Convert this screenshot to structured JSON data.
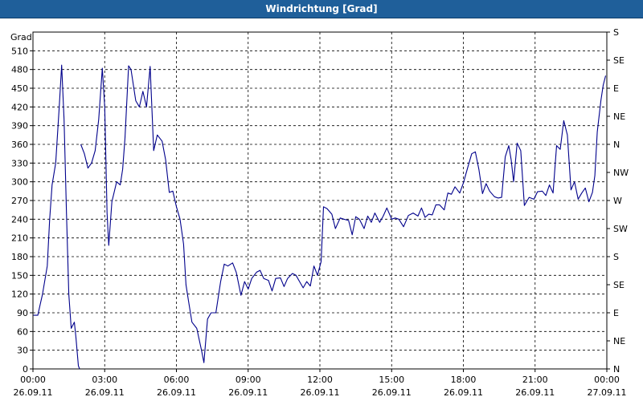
{
  "window": {
    "title": "Windrichtung [Grad]"
  },
  "chart_data": {
    "type": "line",
    "title": "Windrichtung [Grad]",
    "ylabel": "Grad",
    "ylim": [
      0,
      540
    ],
    "xlim": [
      0,
      24
    ],
    "grid": true,
    "yticks": [
      0,
      30,
      60,
      90,
      120,
      150,
      180,
      210,
      240,
      270,
      300,
      330,
      360,
      390,
      420,
      450,
      480,
      510
    ],
    "right_ticks": [
      {
        "value": 0,
        "label": "N"
      },
      {
        "value": 45,
        "label": "NE"
      },
      {
        "value": 90,
        "label": "E"
      },
      {
        "value": 135,
        "label": "SE"
      },
      {
        "value": 180,
        "label": "S"
      },
      {
        "value": 225,
        "label": "SW"
      },
      {
        "value": 270,
        "label": "W"
      },
      {
        "value": 315,
        "label": "NW"
      },
      {
        "value": 360,
        "label": "N"
      },
      {
        "value": 405,
        "label": "NE"
      },
      {
        "value": 450,
        "label": "E"
      },
      {
        "value": 495,
        "label": "SE"
      },
      {
        "value": 540,
        "label": "S"
      }
    ],
    "xticks": [
      {
        "value": 0,
        "time": "00:00",
        "date": "26.09.11"
      },
      {
        "value": 3,
        "time": "03:00",
        "date": "26.09.11"
      },
      {
        "value": 6,
        "time": "06:00",
        "date": "26.09.11"
      },
      {
        "value": 9,
        "time": "09:00",
        "date": "26.09.11"
      },
      {
        "value": 12,
        "time": "12:00",
        "date": "26.09.11"
      },
      {
        "value": 15,
        "time": "15:00",
        "date": "26.09.11"
      },
      {
        "value": 18,
        "time": "18:00",
        "date": "26.09.11"
      },
      {
        "value": 21,
        "time": "21:00",
        "date": "26.09.11"
      },
      {
        "value": 24,
        "time": "00:00",
        "date": "27.09.11"
      }
    ],
    "series": [
      {
        "color": "#00008b",
        "segments": [
          [
            [
              0.02,
              86
            ],
            [
              0.2,
              86
            ],
            [
              0.4,
              120
            ],
            [
              0.6,
              165
            ],
            [
              0.7,
              240
            ],
            [
              0.8,
              295
            ],
            [
              0.95,
              330
            ],
            [
              1.1,
              420
            ],
            [
              1.2,
              487
            ],
            [
              1.3,
              400
            ],
            [
              1.4,
              250
            ],
            [
              1.5,
              120
            ],
            [
              1.6,
              65
            ],
            [
              1.73,
              75
            ],
            [
              1.8,
              50
            ],
            [
              1.9,
              5
            ],
            [
              1.95,
              0
            ]
          ],
          [
            [
              2.0,
              360
            ],
            [
              2.15,
              345
            ],
            [
              2.3,
              322
            ],
            [
              2.45,
              330
            ],
            [
              2.6,
              350
            ],
            [
              2.75,
              400
            ],
            [
              2.9,
              482
            ],
            [
              3.0,
              420
            ],
            [
              3.1,
              250
            ],
            [
              3.17,
              198
            ],
            [
              3.3,
              268
            ],
            [
              3.5,
              300
            ],
            [
              3.65,
              295
            ],
            [
              3.75,
              320
            ],
            [
              3.85,
              370
            ],
            [
              4.0,
              486
            ],
            [
              4.1,
              480
            ],
            [
              4.3,
              430
            ],
            [
              4.45,
              420
            ],
            [
              4.6,
              445
            ],
            [
              4.75,
              420
            ],
            [
              4.9,
              485
            ],
            [
              5.05,
              350
            ],
            [
              5.2,
              375
            ],
            [
              5.4,
              365
            ],
            [
              5.55,
              335
            ],
            [
              5.7,
              283
            ],
            [
              5.85,
              285
            ],
            [
              6.0,
              260
            ],
            [
              6.15,
              240
            ],
            [
              6.3,
              200
            ],
            [
              6.4,
              135
            ],
            [
              6.5,
              110
            ],
            [
              6.65,
              75
            ],
            [
              6.85,
              65
            ],
            [
              7.05,
              30
            ],
            [
              7.15,
              10
            ],
            [
              7.3,
              80
            ],
            [
              7.45,
              90
            ],
            [
              7.65,
              90
            ],
            [
              7.85,
              140
            ],
            [
              8.0,
              168
            ],
            [
              8.15,
              165
            ],
            [
              8.35,
              170
            ],
            [
              8.5,
              155
            ],
            [
              8.7,
              118
            ],
            [
              8.85,
              140
            ],
            [
              9.0,
              128
            ],
            [
              9.15,
              145
            ],
            [
              9.35,
              155
            ],
            [
              9.5,
              158
            ],
            [
              9.65,
              145
            ],
            [
              9.85,
              142
            ],
            [
              10.0,
              125
            ],
            [
              10.15,
              145
            ],
            [
              10.35,
              146
            ],
            [
              10.5,
              132
            ],
            [
              10.65,
              145
            ],
            [
              10.85,
              153
            ],
            [
              11.0,
              150
            ],
            [
              11.15,
              140
            ],
            [
              11.3,
              130
            ],
            [
              11.45,
              140
            ],
            [
              11.6,
              133
            ],
            [
              11.75,
              165
            ],
            [
              11.9,
              150
            ],
            [
              12.05,
              172
            ],
            [
              12.15,
              260
            ],
            [
              12.3,
              257
            ],
            [
              12.5,
              248
            ],
            [
              12.65,
              225
            ],
            [
              12.85,
              242
            ],
            [
              13.0,
              240
            ],
            [
              13.2,
              238
            ],
            [
              13.35,
              215
            ],
            [
              13.5,
              244
            ],
            [
              13.65,
              240
            ],
            [
              13.85,
              225
            ],
            [
              14.0,
              245
            ],
            [
              14.15,
              235
            ],
            [
              14.3,
              250
            ],
            [
              14.5,
              235
            ],
            [
              14.65,
              245
            ],
            [
              14.8,
              258
            ],
            [
              15.0,
              240
            ],
            [
              15.15,
              242
            ],
            [
              15.3,
              240
            ],
            [
              15.5,
              228
            ],
            [
              15.7,
              246
            ],
            [
              15.9,
              250
            ],
            [
              16.1,
              245
            ],
            [
              16.25,
              258
            ],
            [
              16.4,
              243
            ],
            [
              16.55,
              248
            ],
            [
              16.7,
              247
            ],
            [
              16.85,
              263
            ],
            [
              17.0,
              263
            ],
            [
              17.2,
              255
            ],
            [
              17.35,
              282
            ],
            [
              17.5,
              280
            ],
            [
              17.65,
              292
            ],
            [
              17.85,
              282
            ],
            [
              18.0,
              298
            ],
            [
              18.2,
              325
            ],
            [
              18.35,
              345
            ],
            [
              18.5,
              348
            ],
            [
              18.65,
              320
            ],
            [
              18.8,
              281
            ],
            [
              18.95,
              297
            ],
            [
              19.1,
              285
            ],
            [
              19.3,
              276
            ],
            [
              19.45,
              274
            ],
            [
              19.6,
              275
            ],
            [
              19.75,
              340
            ],
            [
              19.9,
              358
            ],
            [
              20.0,
              335
            ],
            [
              20.1,
              300
            ],
            [
              20.25,
              362
            ],
            [
              20.4,
              350
            ],
            [
              20.55,
              262
            ],
            [
              20.75,
              275
            ],
            [
              20.95,
              272
            ],
            [
              21.1,
              284
            ],
            [
              21.3,
              285
            ],
            [
              21.45,
              278
            ],
            [
              21.6,
              295
            ],
            [
              21.75,
              282
            ],
            [
              21.9,
              358
            ],
            [
              22.05,
              352
            ],
            [
              22.2,
              398
            ],
            [
              22.35,
              375
            ],
            [
              22.5,
              287
            ],
            [
              22.65,
              300
            ],
            [
              22.8,
              272
            ],
            [
              22.95,
              282
            ],
            [
              23.1,
              290
            ],
            [
              23.25,
              268
            ],
            [
              23.4,
              283
            ],
            [
              23.5,
              310
            ],
            [
              23.6,
              380
            ],
            [
              23.75,
              430
            ],
            [
              23.85,
              455
            ],
            [
              23.95,
              470
            ]
          ]
        ]
      }
    ]
  }
}
